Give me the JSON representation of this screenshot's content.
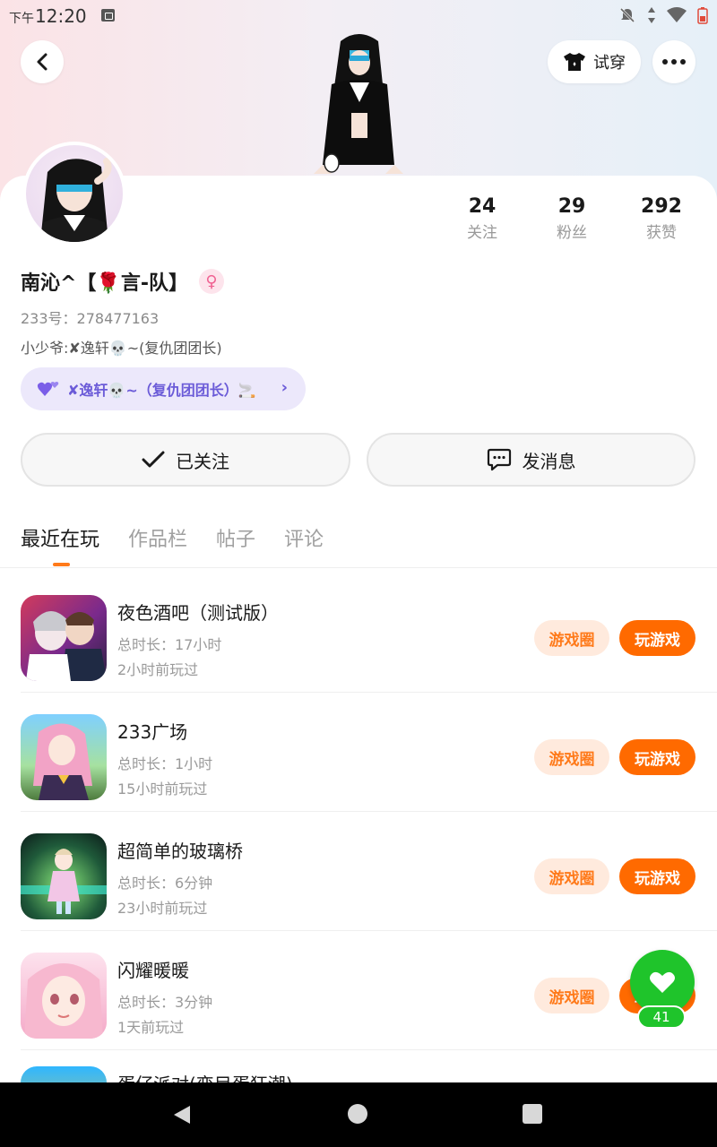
{
  "status_bar": {
    "ampm": "下午",
    "time": "12:20"
  },
  "header": {
    "tryon_label": "试穿"
  },
  "profile": {
    "name": "南沁^【🌹言-队】",
    "uid": "233号：278477163",
    "bio": "小少爷:✘逸轩💀~(复仇团团长)",
    "team_label": "✘逸轩💀~（复仇团团长）🚬",
    "stats": [
      {
        "value": "24",
        "label": "关注"
      },
      {
        "value": "29",
        "label": "粉丝"
      },
      {
        "value": "292",
        "label": "获赞"
      }
    ]
  },
  "actions": {
    "follow_label": "已关注",
    "message_label": "发消息"
  },
  "tabs": [
    "最近在玩",
    "作品栏",
    "帖子",
    "评论"
  ],
  "games": [
    {
      "title": "夜色酒吧（测试版）",
      "duration": "总时长：17小时",
      "last_played": "2小时前玩过"
    },
    {
      "title": "233广场",
      "duration": "总时长：1小时",
      "last_played": "15小时前玩过"
    },
    {
      "title": "超简单的玻璃桥",
      "duration": "总时长：6分钟",
      "last_played": "23小时前玩过"
    },
    {
      "title": "闪耀暖暖",
      "duration": "总时长：3分钟",
      "last_played": "1天前玩过"
    },
    {
      "title": "蛋仔派对(变目蛋狂潮)",
      "duration": "",
      "last_played": ""
    }
  ],
  "game_buttons": {
    "circle": "游戏圈",
    "play": "玩游戏"
  },
  "fab": {
    "count": "41"
  },
  "colors": {
    "accent": "#ff6a00",
    "accent_light": "#ffeadd",
    "fab": "#1fc42b",
    "team_pill": "#ece8fb"
  }
}
